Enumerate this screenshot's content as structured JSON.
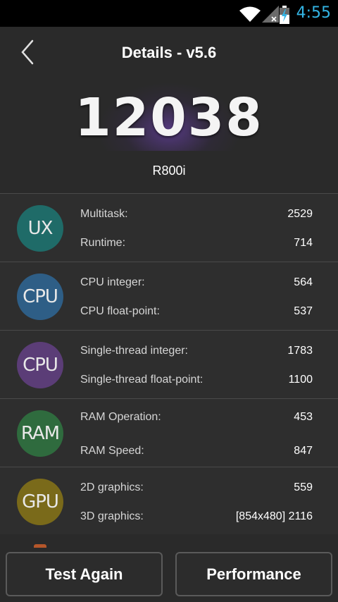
{
  "status_bar": {
    "time": "4:55",
    "time_color": "#33b5e5",
    "icons": [
      "wifi-icon",
      "signal-icon",
      "battery-charging-icon"
    ]
  },
  "header": {
    "title": "Details - v5.6",
    "back_icon": "chevron-left-icon",
    "score": "12038",
    "device": "R800i"
  },
  "sections": {
    "ux": {
      "badge": "UX",
      "color": "#1f6b68",
      "rows": [
        {
          "label": "Multitask:",
          "value": "2529"
        },
        {
          "label": "Runtime:",
          "value": "714"
        }
      ]
    },
    "cpu": {
      "badge": "CPU",
      "color": "#2e5e86",
      "rows": [
        {
          "label": "CPU integer:",
          "value": "564"
        },
        {
          "label": "CPU float-point:",
          "value": "537"
        }
      ]
    },
    "cpu_single": {
      "badge": "CPU",
      "color": "#5b3d77",
      "rows": [
        {
          "label": "Single-thread integer:",
          "value": "1783"
        },
        {
          "label": "Single-thread float-point:",
          "value": "1100"
        }
      ]
    },
    "ram": {
      "badge": "RAM",
      "color": "#2f6b3e",
      "rows": [
        {
          "label": "RAM Operation:",
          "value": "453"
        },
        {
          "label": "RAM Speed:",
          "value": "847"
        }
      ]
    },
    "gpu": {
      "badge": "GPU",
      "color": "#7a6a1a",
      "rows": [
        {
          "label": "2D graphics:",
          "value": "559"
        },
        {
          "label": "3D graphics:",
          "value": "[854x480] 2116"
        }
      ]
    }
  },
  "buttons": {
    "test_again": "Test Again",
    "performance": "Performance"
  }
}
